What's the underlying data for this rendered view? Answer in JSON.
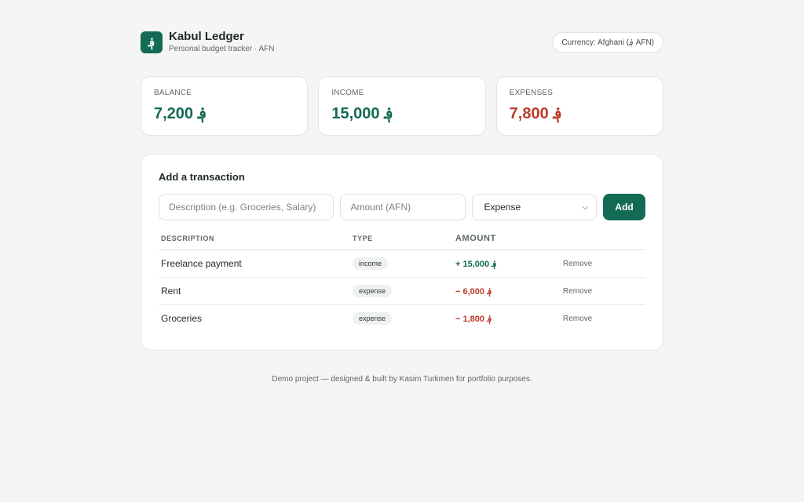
{
  "header": {
    "logo_glyph": "؋",
    "title": "Kabul Ledger",
    "subtitle": "Personal budget tracker · AFN",
    "currency_label": "Currency: Afghani (؋ AFN)"
  },
  "stats": [
    {
      "label": "BALANCE",
      "value": "7,200 ؋",
      "color": "#136b55"
    },
    {
      "label": "INCOME",
      "value": "15,000 ؋",
      "color": "#136b55"
    },
    {
      "label": "EXPENSES",
      "value": "7,800 ؋",
      "color": "#c0392b"
    }
  ],
  "form": {
    "title": "Add a transaction",
    "description_placeholder": "Description (e.g. Groceries, Salary)",
    "amount_placeholder": "Amount (AFN)",
    "type_selected": "Expense",
    "add_label": "Add"
  },
  "table": {
    "headers": [
      "DESCRIPTION",
      "TYPE",
      "AMOUNT",
      ""
    ],
    "rows": [
      {
        "description": "Freelance payment",
        "type": "income",
        "amount": "+ 15,000 ؋",
        "remove": "Remove"
      },
      {
        "description": "Rent",
        "type": "expense",
        "amount": "− 6,000 ؋",
        "remove": "Remove"
      },
      {
        "description": "Groceries",
        "type": "expense",
        "amount": "− 1,800 ؋",
        "remove": "Remove"
      }
    ]
  },
  "footer": "Demo project — designed & built by Kasim Turkmen for portfolio purposes.",
  "colors": {
    "accent": "#136b55",
    "expense": "#c0392b",
    "background": "#f4f5f4"
  }
}
